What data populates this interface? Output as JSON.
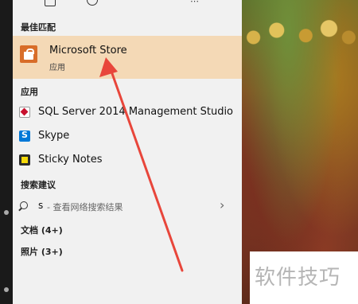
{
  "sections": {
    "best_match": "最佳匹配",
    "apps": "应用",
    "search_suggestions": "搜索建议",
    "documents": "文档 (4+)",
    "photos": "照片 (3+)"
  },
  "top": {
    "more": "⋯"
  },
  "best_match_item": {
    "title": "Microsoft Store",
    "subtitle": "应用",
    "icon": "microsoft-store-icon",
    "highlight_color": "#f4d9b6"
  },
  "apps": [
    {
      "label": "SQL Server 2014 Management Studio",
      "icon": "sql-server-icon"
    },
    {
      "label": "Skype",
      "icon": "skype-icon"
    },
    {
      "label": "Sticky Notes",
      "icon": "sticky-notes-icon"
    }
  ],
  "suggestion": {
    "query": "s",
    "hint": " - 查看网络搜索结果",
    "chevron": "›"
  },
  "watermark": "软件技巧",
  "annotation": {
    "arrow_color": "#e8463b"
  }
}
